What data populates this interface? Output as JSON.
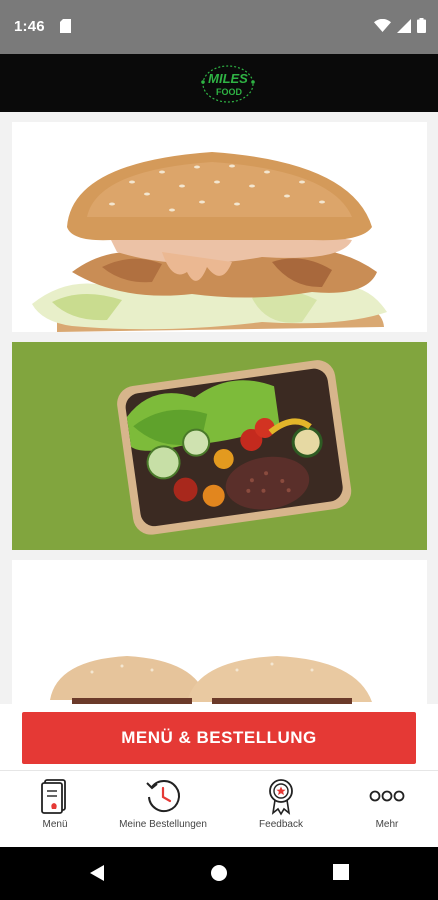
{
  "status_bar": {
    "time": "1:46",
    "icons": [
      "sd-card-icon",
      "wifi-icon",
      "cell-signal-icon",
      "battery-icon"
    ]
  },
  "header": {
    "logo_text": "MILES FOOD",
    "logo_icon": "miles-food-logo",
    "colors": {
      "background": "#0a0a0a",
      "logo_green": "#2fb344"
    }
  },
  "feed": {
    "cards": [
      {
        "name": "burger-photo"
      },
      {
        "name": "bowl-photo"
      },
      {
        "name": "burger-photo-partial"
      }
    ]
  },
  "cta": {
    "label": "MENÜ & BESTELLUNG",
    "color": "#e53935"
  },
  "bottom_nav": {
    "items": [
      {
        "label": "Menü",
        "icon": "menu-card-icon"
      },
      {
        "label": "Meine Bestellungen",
        "icon": "order-history-icon"
      },
      {
        "label": "Feedback",
        "icon": "award-ribbon-icon"
      },
      {
        "label": "Mehr",
        "icon": "more-dots-icon"
      }
    ],
    "accent_color": "#e53935"
  },
  "system_nav": {
    "buttons": [
      "back-icon",
      "home-icon",
      "recents-icon"
    ]
  }
}
